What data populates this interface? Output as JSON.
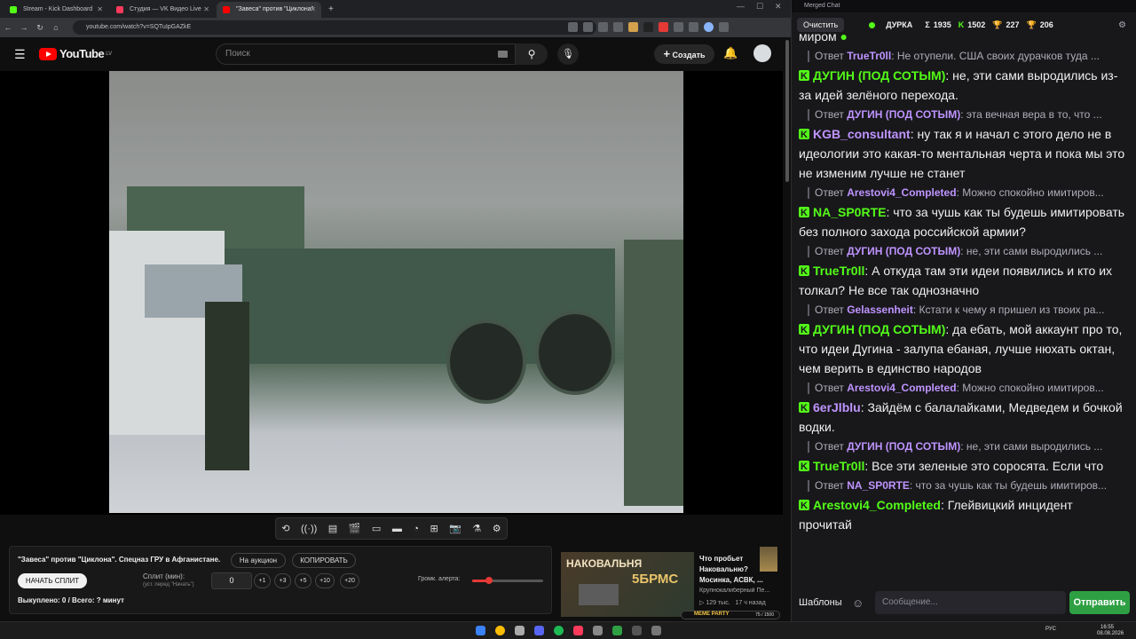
{
  "browser": {
    "tabs": [
      {
        "title": "Stream - Kick Dashboard",
        "color": "#53fc18"
      },
      {
        "title": "Студия — VK Видео Live",
        "color": "#ff3b5c"
      },
      {
        "title": "\"Завеса\" против \"Циклона\"",
        "color": "#ff0000"
      }
    ],
    "new_tab": "+",
    "url": "youtube.com/watch?v=SQTuIpGAZkE"
  },
  "youtube": {
    "logo_text": "YouTube",
    "region": "LV",
    "search_placeholder": "Поиск",
    "create_label": "Создать",
    "video_title": "\"Завеса\" против \"Циклона\". Спецназ ГРУ в Афганистане."
  },
  "panel": {
    "auction_label": "На аукцион",
    "copy_label": "КОПИРОВАТЬ",
    "start_split_label": "НАЧАТЬ СПЛИТ",
    "split_label": "Сплит (мин):",
    "split_hint": "(уст. перед \"Начать\")",
    "split_value": "0",
    "increments": [
      "+1",
      "+3",
      "+5",
      "+10",
      "+20"
    ],
    "alert_volume_label": "Громк. алерта:",
    "alert_volume_level": 0.24,
    "status_text": "Выкуплено: 0 / Всего: ? минут"
  },
  "suggestion": {
    "thumb_text": "НАКОВАЛЬНЯ",
    "thumb_text2": "5БРМС",
    "title": "Что пробьет Наковальню? Мосинка, АСВК, ...",
    "channel": "Крупнокалиберный Пе...",
    "meta": "▷ 129 тыс.   17 ч назад",
    "meme_badge": "MEME PARTY",
    "meme_count": "75 / 1500"
  },
  "chat": {
    "window_title": "Merged Chat",
    "clear_label": "Очистить",
    "channel": "ДУРКА",
    "stats": [
      {
        "icon": "Σ",
        "value": "1935",
        "color": "#efeff1"
      },
      {
        "icon": "K",
        "value": "1502",
        "color": "#53fc18"
      },
      {
        "icon": "🏆",
        "value": "227",
        "color": "#e6b800"
      },
      {
        "icon": "🏆",
        "value": "206",
        "color": "#53fc18"
      }
    ],
    "top_fragment": "миром",
    "messages": [
      {
        "type": "reply",
        "prefix": "Ответ",
        "nick": "TrueTr0ll",
        "text": ": Не отупели. США своих дурачков туда ..."
      },
      {
        "type": "msg",
        "nick": "ДУГИН (ПОД СОТЫМ)",
        "nick_color": "#53fc18",
        "text": ": не, эти сами выродились из-за идей зелёного перехода."
      },
      {
        "type": "reply",
        "prefix": "Ответ",
        "nick": "ДУГИН (ПОД СОТЫМ)",
        "text": ": эта вечная вера в то, что ..."
      },
      {
        "type": "msg",
        "nick": "KGB_consultant",
        "nick_color": "#bf94ff",
        "text": ": ну так я и начал с этого дело не в идеологии это какая-то ментальная черта и пока мы это не изменим лучше не станет"
      },
      {
        "type": "reply",
        "prefix": "Ответ",
        "nick": "Arestovi4_Completed",
        "text": ": Можно спокойно имитиров..."
      },
      {
        "type": "msg",
        "nick": "NA_SP0RTE",
        "nick_color": "#53fc18",
        "text": ": что за чушь как ты будешь имитировать без полного захода российской армии?"
      },
      {
        "type": "reply",
        "prefix": "Ответ",
        "nick": "ДУГИН (ПОД СОТЫМ)",
        "text": ": не, эти сами выродились ..."
      },
      {
        "type": "msg",
        "nick": "TrueTr0ll",
        "nick_color": "#53fc18",
        "text": ": А откуда там эти идеи появились и кто их толкал? Не все так однозначно"
      },
      {
        "type": "reply",
        "prefix": "Ответ",
        "nick": "Gelassenheit",
        "text": ": Кстати к чему я пришел из твоих ра..."
      },
      {
        "type": "msg",
        "nick": "ДУГИН (ПОД СОТЫМ)",
        "nick_color": "#53fc18",
        "text": ": да ебать, мой аккаунт про то, что идеи Дугина - залупа ебаная, лучше нюхать октан, чем верить в единство народов"
      },
      {
        "type": "reply",
        "prefix": "Ответ",
        "nick": "Arestovi4_Completed",
        "text": ": Можно спокойно имитиров..."
      },
      {
        "type": "msg",
        "nick": "6erJlblu",
        "nick_color": "#bf94ff",
        "text": ": Зайдём с балалайками, Медведем и бочкой водки."
      },
      {
        "type": "reply",
        "prefix": "Ответ",
        "nick": "ДУГИН (ПОД СОТЫМ)",
        "text": ": не, эти сами выродились ..."
      },
      {
        "type": "msg",
        "nick": "TrueTr0ll",
        "nick_color": "#53fc18",
        "text": ": Все эти зеленые это соросята. Если что"
      },
      {
        "type": "reply",
        "prefix": "Ответ",
        "nick": "NA_SP0RTE",
        "text": ": что за чушь как ты будешь имитиров..."
      },
      {
        "type": "msg",
        "nick": "Arestovi4_Completed",
        "nick_color": "#53fc18",
        "text": ": Глейвицкий инцидент прочитай"
      }
    ],
    "templates_label": "Шаблоны",
    "input_placeholder": "Сообщение...",
    "send_label": "Отправить"
  },
  "taskbar": {
    "lang": "РУС",
    "time": "16:55",
    "date": "08.08.2026"
  }
}
